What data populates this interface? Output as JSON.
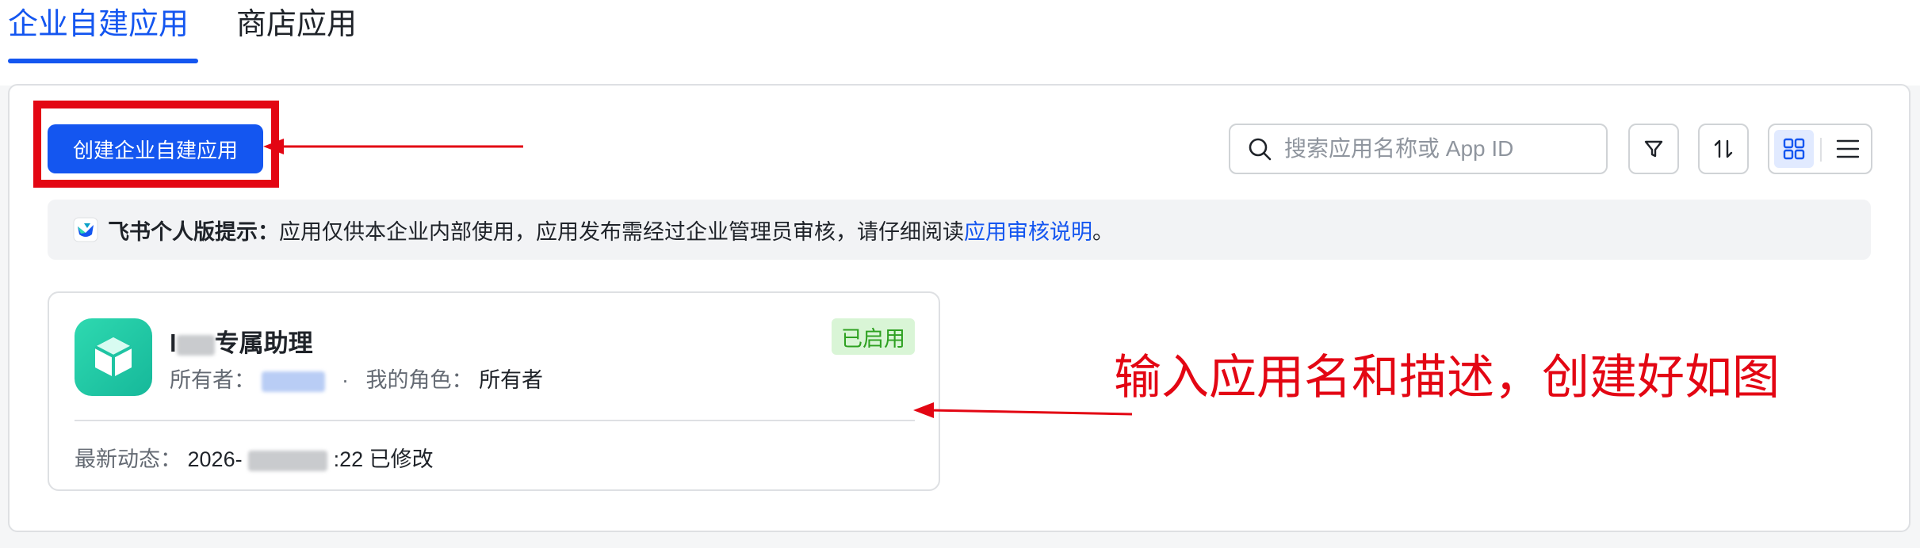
{
  "tabs": [
    {
      "label": "企业自建应用",
      "active": true
    },
    {
      "label": "商店应用",
      "active": false
    }
  ],
  "toolbar": {
    "create_label": "创建企业自建应用",
    "search_placeholder": "搜索应用名称或 App ID",
    "icons": [
      "filter-icon",
      "sort-icon",
      "grid-view-icon",
      "list-view-icon"
    ]
  },
  "notice": {
    "title": "飞书个人版提示：",
    "text": "应用仅供本企业内部使用，应用发布需经过企业管理员审核，请仔细阅读 ",
    "link": "应用审核说明",
    "suffix": "。"
  },
  "app_card": {
    "name_suffix": "专属助理",
    "status": "已启用",
    "owner_label": "所有者：",
    "separator": "·",
    "role_label": "我的角色：",
    "role_value": "所有者",
    "activity_label": "最新动态：",
    "activity_year": "2026-",
    "activity_tail": ":22 已修改"
  },
  "annotation": {
    "text": "输入应用名和描述，创建好如图"
  },
  "colors": {
    "accent": "#1456f0",
    "annotation_red": "#e30613",
    "status_green": "#2ea121"
  }
}
